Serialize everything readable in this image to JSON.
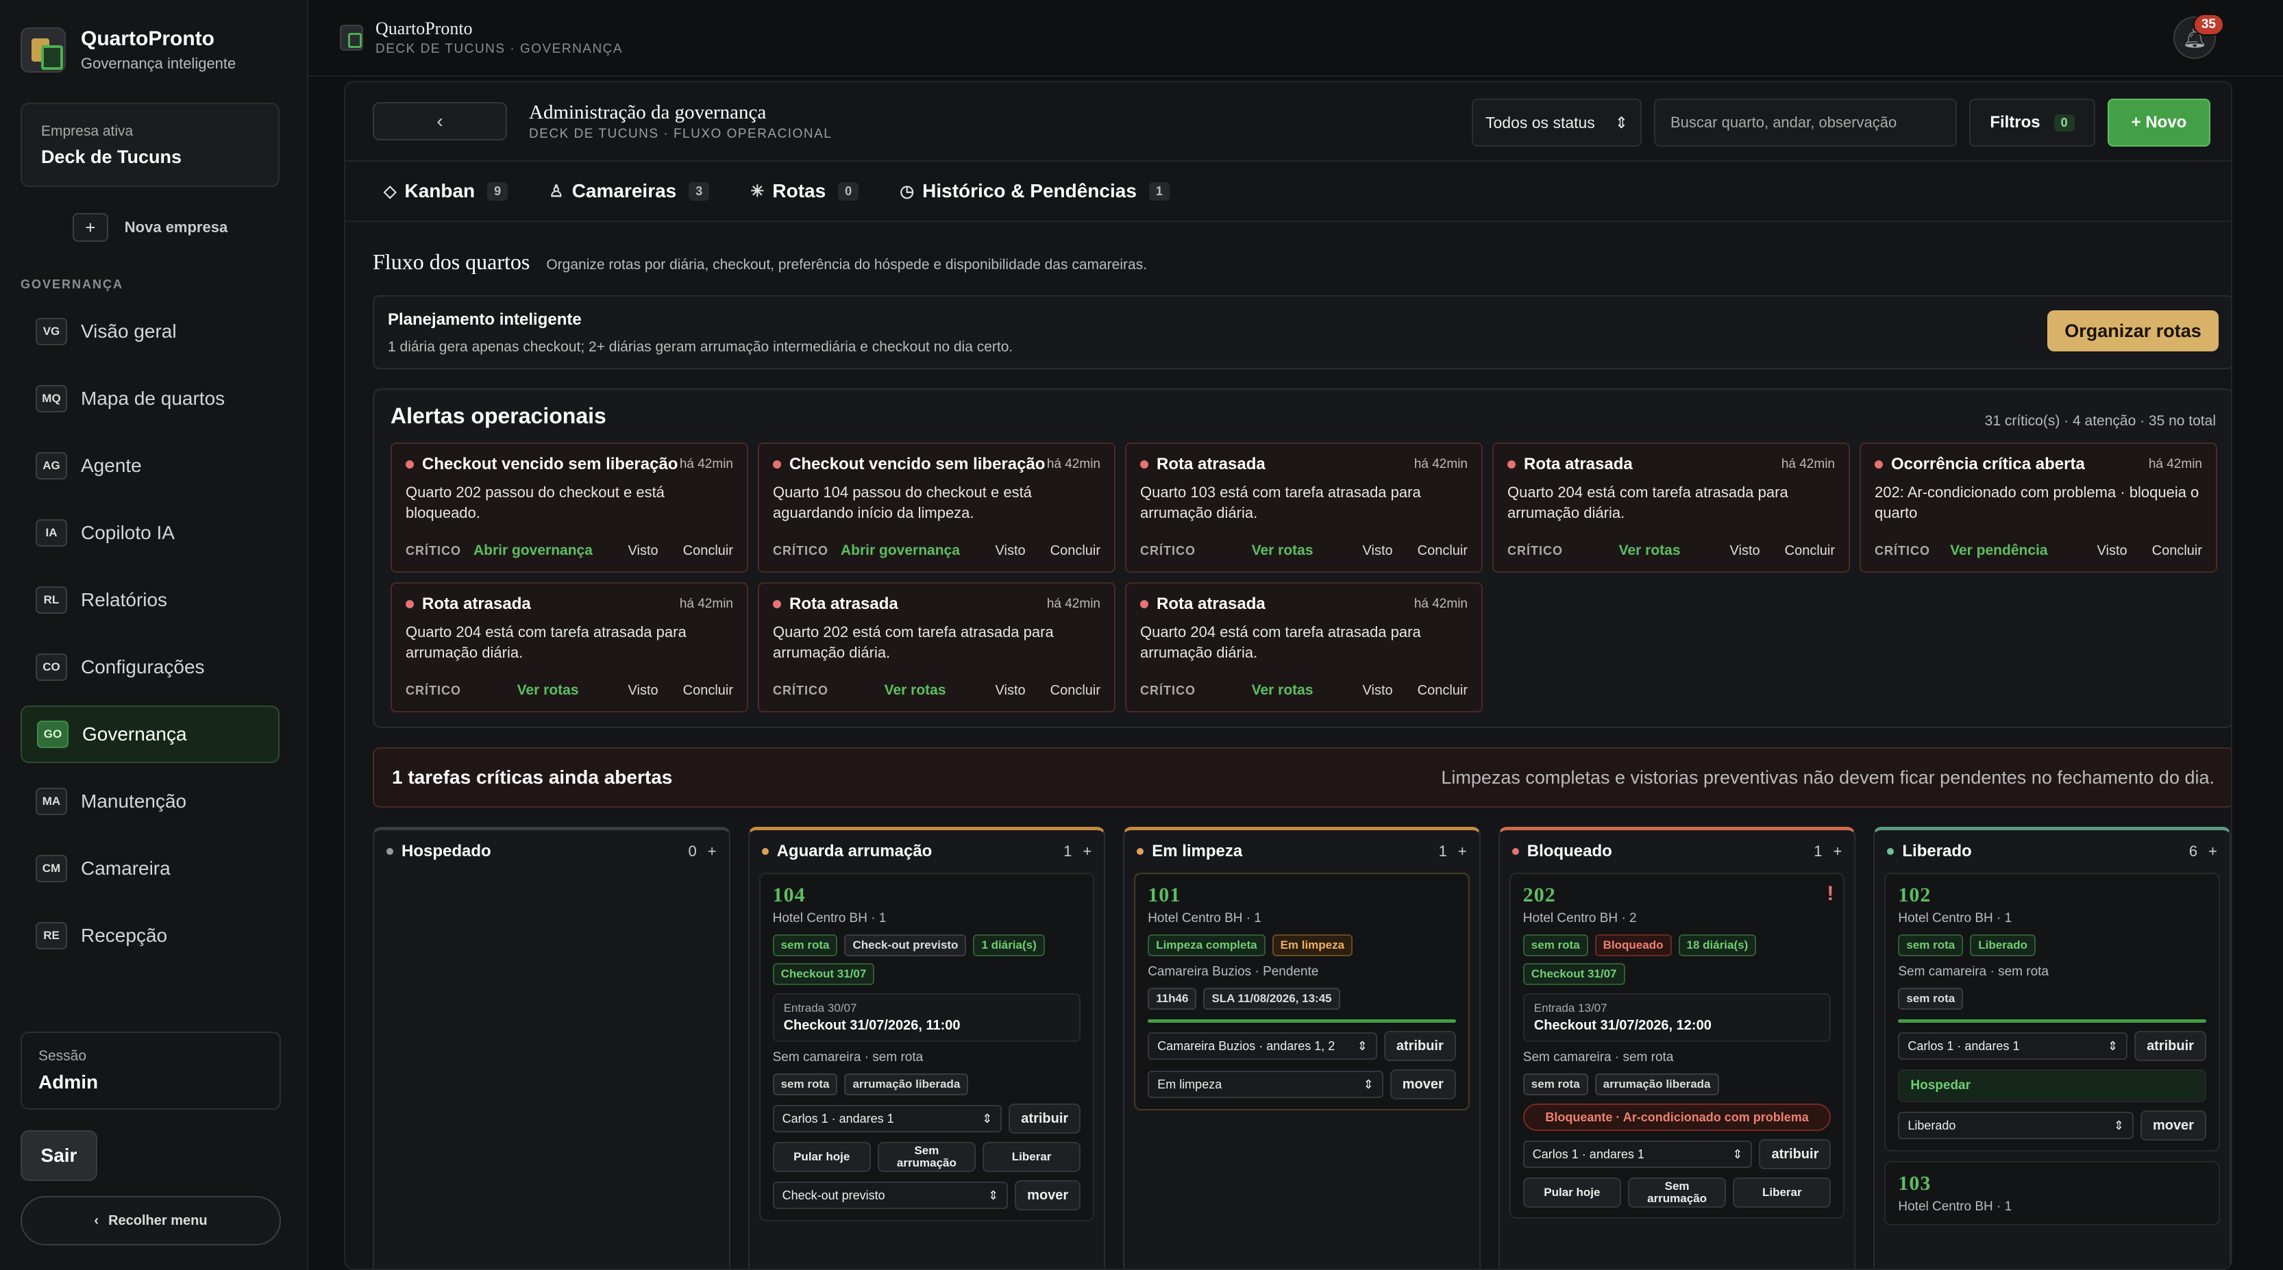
{
  "sidebar": {
    "brand_name": "QuartoPronto",
    "brand_sub": "Governança inteligente",
    "company_label": "Empresa ativa",
    "company_name": "Deck de Tucuns",
    "new_company": "Nova empresa",
    "section": "GOVERNANÇA",
    "items": [
      {
        "code": "VG",
        "label": "Visão geral"
      },
      {
        "code": "MQ",
        "label": "Mapa de quartos"
      },
      {
        "code": "AG",
        "label": "Agente"
      },
      {
        "code": "IA",
        "label": "Copiloto IA"
      },
      {
        "code": "RL",
        "label": "Relatórios"
      },
      {
        "code": "CO",
        "label": "Configurações"
      },
      {
        "code": "GO",
        "label": "Governança"
      },
      {
        "code": "MA",
        "label": "Manutenção"
      },
      {
        "code": "CM",
        "label": "Camareira"
      },
      {
        "code": "RE",
        "label": "Recepção"
      }
    ],
    "session_label": "Sessão",
    "session_user": "Admin",
    "logout": "Sair",
    "collapse": "Recolher menu"
  },
  "topbar": {
    "title": "QuartoPronto",
    "subtitle": "DECK DE TUCUNS · GOVERNANÇA",
    "notifications": "35"
  },
  "header": {
    "back": "‹",
    "title": "Administração da governança",
    "subtitle": "DECK DE TUCUNS · FLUXO OPERACIONAL",
    "status_select": "Todos os status",
    "search_placeholder": "Buscar quarto, andar, observação",
    "filters": "Filtros",
    "filters_count": "0",
    "new": "+ Novo"
  },
  "tabs": [
    {
      "icon": "◇",
      "label": "Kanban",
      "count": "9"
    },
    {
      "icon": "♙",
      "label": "Camareiras",
      "count": "3"
    },
    {
      "icon": "✳",
      "label": "Rotas",
      "count": "0"
    },
    {
      "icon": "◷",
      "label": "Histórico & Pendências",
      "count": "1"
    }
  ],
  "flow": {
    "title": "Fluxo dos quartos",
    "desc": "Organize rotas por diária, checkout, preferência do hóspede e disponibilidade das camareiras."
  },
  "plan": {
    "title": "Planejamento inteligente",
    "desc": "1 diária gera apenas checkout; 2+ diárias geram arrumação intermediária e checkout no dia certo.",
    "button": "Organizar rotas"
  },
  "alerts": {
    "title": "Alertas operacionais",
    "summary": "31 crítico(s) · 4 atenção · 35 no total",
    "items": [
      {
        "title": "Checkout vencido sem liberação",
        "ago": "há 42min",
        "desc": "Quarto 202 passou do checkout e está bloqueado.",
        "level": "CRÍTICO",
        "link": "Abrir governança",
        "seen": "Visto",
        "done": "Concluir"
      },
      {
        "title": "Checkout vencido sem liberação",
        "ago": "há 42min",
        "desc": "Quarto 104 passou do checkout e está aguardando início da limpeza.",
        "level": "CRÍTICO",
        "link": "Abrir governança",
        "seen": "Visto",
        "done": "Concluir"
      },
      {
        "title": "Rota atrasada",
        "ago": "há 42min",
        "desc": "Quarto 103 está com tarefa atrasada para arrumação diária.",
        "level": "CRÍTICO",
        "link": "Ver rotas",
        "seen": "Visto",
        "done": "Concluir"
      },
      {
        "title": "Rota atrasada",
        "ago": "há 42min",
        "desc": "Quarto 204 está com tarefa atrasada para arrumação diária.",
        "level": "CRÍTICO",
        "link": "Ver rotas",
        "seen": "Visto",
        "done": "Concluir"
      },
      {
        "title": "Ocorrência crítica aberta",
        "ago": "há 42min",
        "desc": "202: Ar-condicionado com problema · bloqueia o quarto",
        "level": "CRÍTICO",
        "link": "Ver pendência",
        "seen": "Visto",
        "done": "Concluir"
      },
      {
        "title": "Rota atrasada",
        "ago": "há 42min",
        "desc": "Quarto 204 está com tarefa atrasada para arrumação diária.",
        "level": "CRÍTICO",
        "link": "Ver rotas",
        "seen": "Visto",
        "done": "Concluir"
      },
      {
        "title": "Rota atrasada",
        "ago": "há 42min",
        "desc": "Quarto 202 está com tarefa atrasada para arrumação diária.",
        "level": "CRÍTICO",
        "link": "Ver rotas",
        "seen": "Visto",
        "done": "Concluir"
      },
      {
        "title": "Rota atrasada",
        "ago": "há 42min",
        "desc": "Quarto 204 está com tarefa atrasada para arrumação diária.",
        "level": "CRÍTICO",
        "link": "Ver rotas",
        "seen": "Visto",
        "done": "Concluir"
      }
    ]
  },
  "tasks": {
    "title": "1 tarefas críticas ainda abertas",
    "desc": "Limpezas completas e vistorias preventivas não devem ficar pendentes no fechamento do dia."
  },
  "columns": {
    "hospedado": {
      "title": "Hospedado",
      "count": "0"
    },
    "aguarda": {
      "title": "Aguarda arrumação",
      "count": "1",
      "card": {
        "room": "104",
        "hotel": "Hotel Centro BH · 1",
        "tags": [
          "sem rota",
          "Check-out previsto",
          "1 diária(s)",
          "Checkout 31/07"
        ],
        "entry_label": "Entrada 30/07",
        "entry_value": "Checkout 31/07/2026, 11:00",
        "info": "Sem camareira · sem rota",
        "tags2": [
          "sem rota",
          "arrumação liberada"
        ],
        "assign_select": "Carlos 1 · andares 1",
        "assign": "atribuir",
        "b1": "Pular hoje",
        "b2": "Sem arrumação",
        "b3": "Liberar",
        "move_select": "Check-out previsto",
        "move": "mover"
      }
    },
    "limpeza": {
      "title": "Em limpeza",
      "count": "1",
      "card": {
        "room": "101",
        "hotel": "Hotel Centro BH · 1",
        "tags": [
          "Limpeza completa",
          "Em limpeza"
        ],
        "info": "Camareira Buzios · Pendente",
        "tags2": [
          "11h46",
          "SLA 11/08/2026, 13:45"
        ],
        "assign_select": "Camareira Buzios · andares 1, 2",
        "assign": "atribuir",
        "move_select": "Em limpeza",
        "move": "mover"
      }
    },
    "bloqueado": {
      "title": "Bloqueado",
      "count": "1",
      "card": {
        "room": "202",
        "mark": "!",
        "hotel": "Hotel Centro BH · 2",
        "tags": [
          "sem rota",
          "Bloqueado",
          "18 diária(s)",
          "Checkout 31/07"
        ],
        "entry_label": "Entrada 13/07",
        "entry_value": "Checkout 31/07/2026, 12:00",
        "info": "Sem camareira · sem rota",
        "tags2": [
          "sem rota",
          "arrumação liberada"
        ],
        "alert": "Bloqueante · Ar-condicionado com problema",
        "assign_select": "Carlos 1 · andares 1",
        "assign": "atribuir",
        "b1": "Pular hoje",
        "b2": "Sem arrumação",
        "b3": "Liberar"
      }
    },
    "liberado": {
      "title": "Liberado",
      "count": "6",
      "card": {
        "room": "102",
        "hotel": "Hotel Centro BH · 1",
        "tags": [
          "sem rota",
          "Liberado"
        ],
        "info": "Sem camareira · sem rota",
        "tags2": [
          "sem rota"
        ],
        "assign_select": "Carlos 1 · andares 1",
        "assign": "atribuir",
        "state": "Hospedar",
        "move_select": "Liberado",
        "move": "mover"
      },
      "card2": {
        "room": "103",
        "hotel": "Hotel Centro BH · 1"
      }
    },
    "add": "+"
  }
}
